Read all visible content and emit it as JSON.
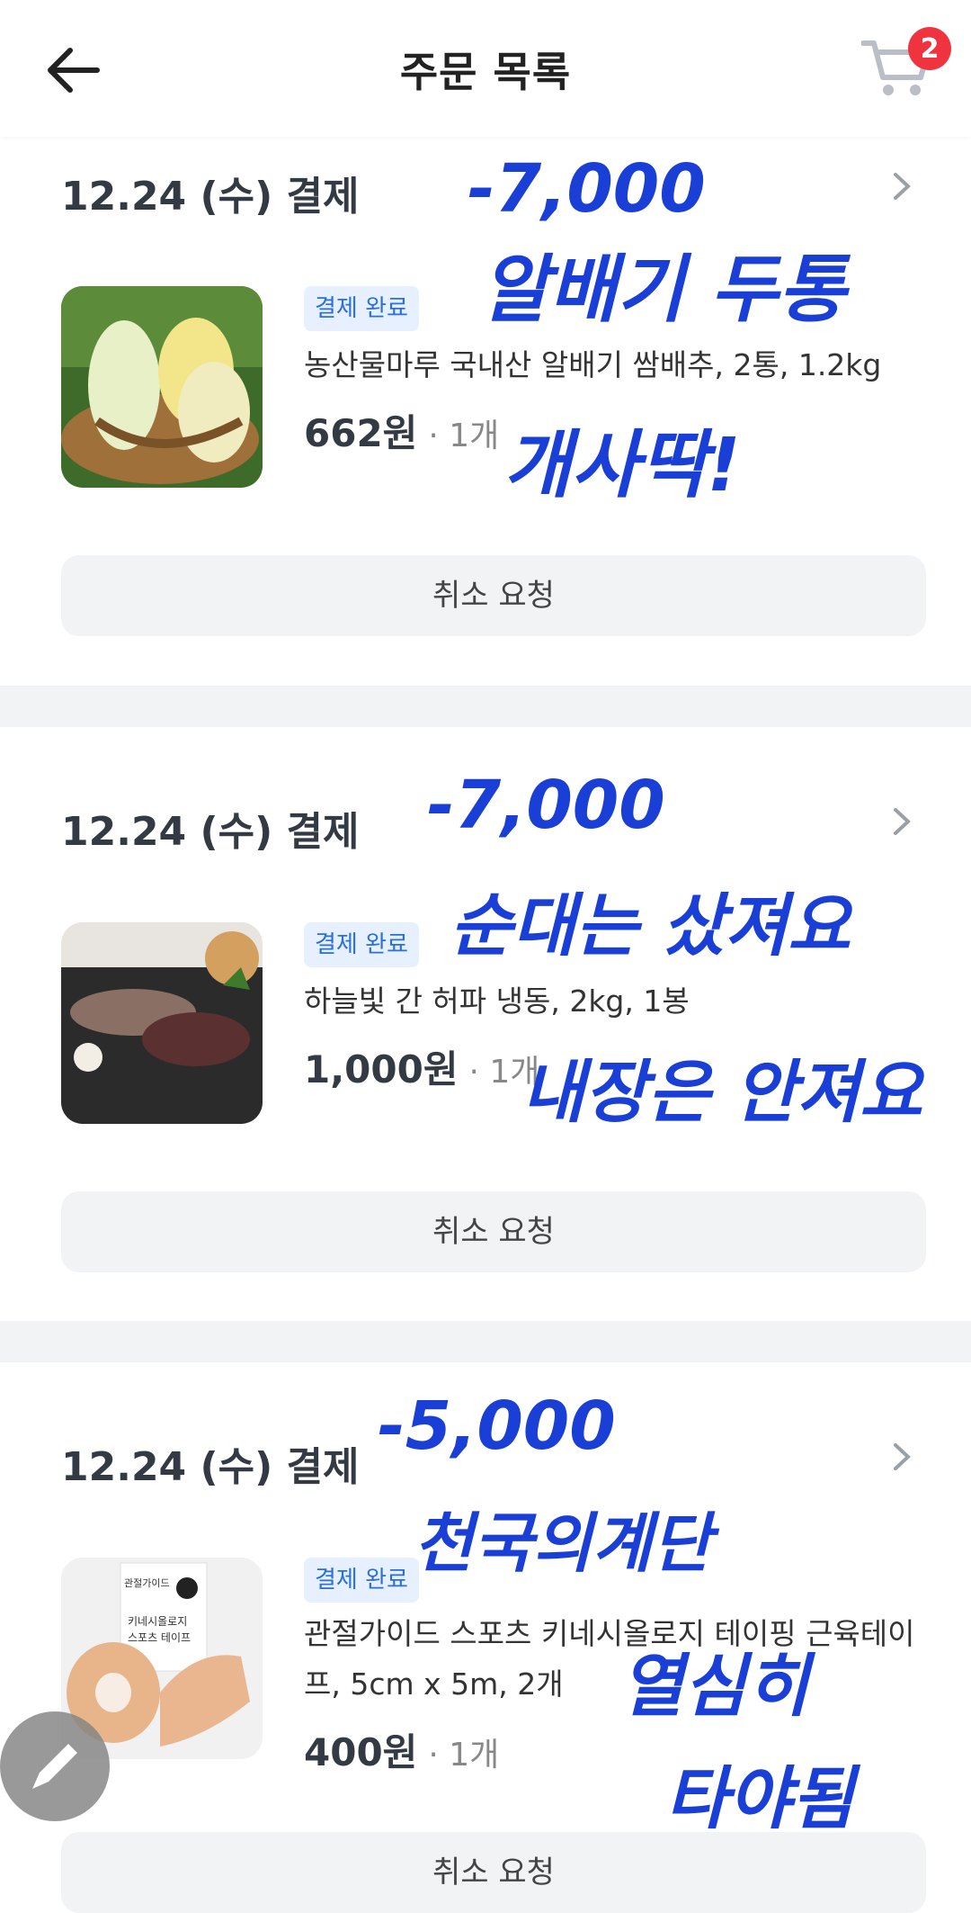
{
  "header": {
    "title": "주문 목록",
    "cart_count": "2"
  },
  "orders": [
    {
      "date": "12.24 (수) 결제",
      "status": "결제 완료",
      "product_name": "농산물마루 국내산 알배기 쌈배추, 2통, 1.2kg",
      "price": "662원",
      "quantity": "· 1개",
      "cancel_label": "취소 요청",
      "note": [
        "-7,000",
        "알배기 두통",
        "개사딱!"
      ]
    },
    {
      "date": "12.24 (수) 결제",
      "status": "결제 완료",
      "product_name": "하늘빛 간 허파 냉동, 2kg, 1봉",
      "price": "1,000원",
      "quantity": "· 1개",
      "cancel_label": "취소 요청",
      "note": [
        "-7,000",
        "순대는 샀져요",
        "내장은 안져요"
      ]
    },
    {
      "date": "12.24 (수) 결제",
      "status": "결제 완료",
      "product_name": "관절가이드 스포츠 키네시올로지 테이핑 근육테이프, 5cm x 5m, 2개",
      "price": "400원",
      "quantity": "· 1개",
      "cancel_label": "취소 요청",
      "product_image_text": [
        "관절가이드",
        "키네시올로지",
        "스포츠 테이프"
      ],
      "note": [
        "-5,000",
        "천국의계단",
        "열심히",
        "타야됨"
      ]
    }
  ],
  "colors": {
    "badge_red": "#f0343f",
    "status_blue": "#2a6fdb",
    "handwriting_blue": "#1a3fd6"
  }
}
